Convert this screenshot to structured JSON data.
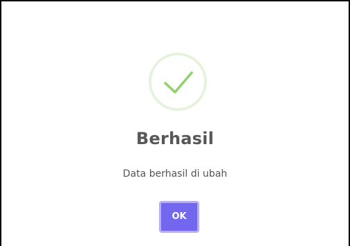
{
  "dialog": {
    "icon": "check-icon",
    "title": "Berhasil",
    "message": "Data berhasil di ubah",
    "ok_label": "OK"
  },
  "colors": {
    "success_check": "#8fd16a",
    "success_ring": "#e6f3dc",
    "confirm_button": "#7367f0",
    "confirm_button_focus": "#b7b0f7",
    "title_text": "#575757",
    "message_text": "#545454"
  }
}
